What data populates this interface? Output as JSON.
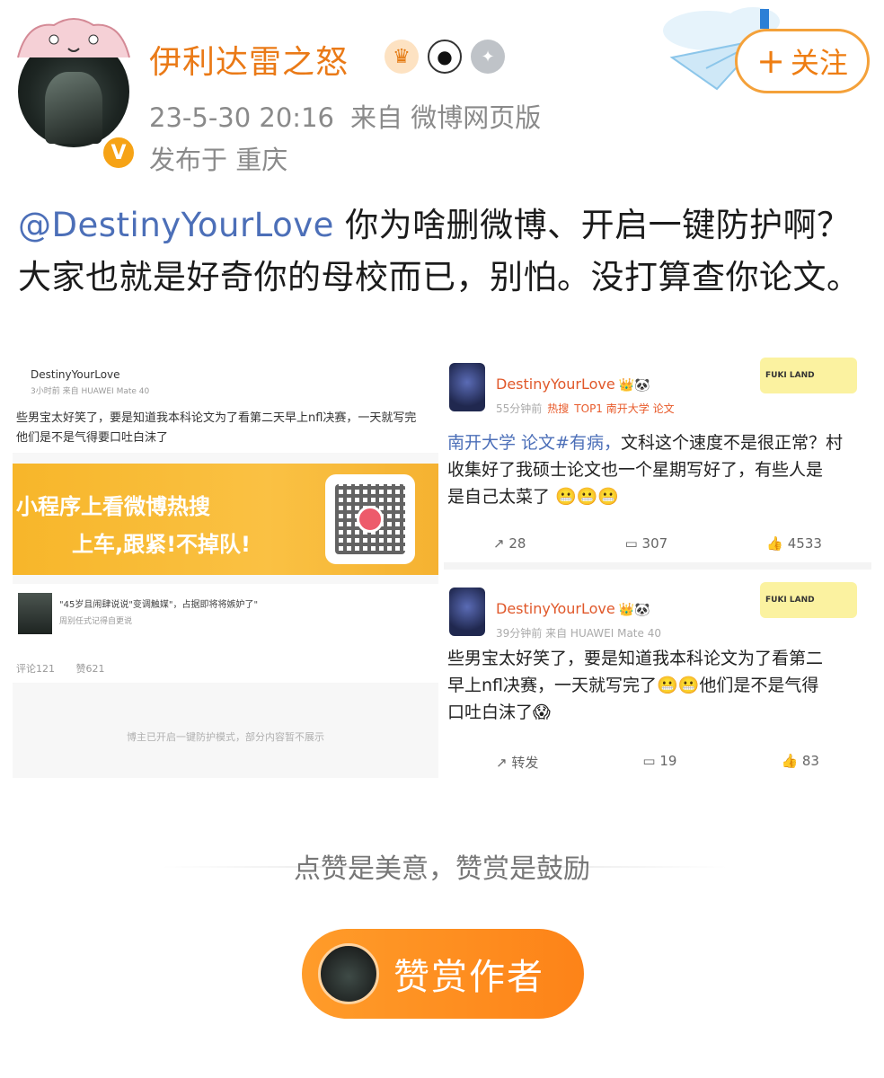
{
  "header": {
    "username": "伊利达雷之怒",
    "time": "23-5-30 20:16",
    "source": "来自 微博网页版",
    "location": "发布于 重庆",
    "follow_label": "关注",
    "verified_mark": "V"
  },
  "post": {
    "mention": "@DestinyYourLove",
    "text": " 你为啥删微博、开启一键防护啊？大家也就是好奇你的母校而已，别怕。没打算查你论文。"
  },
  "left_screenshot": {
    "name": "DestinyYourLove",
    "sub": "3小时前 来自 HUAWEI Mate 40",
    "line1": "些男宝太好笑了，要是知道我本科论文为了看第二天早上nfl决赛，一天就写完",
    "line2": "他们是不是气得要口吐白沫了",
    "banner_line1": "小程序上看微博热搜",
    "banner_line2": "上车,跟紧!不掉队!",
    "card_title": "\"45岁且闹肆说说\"变调触媒\"，占据即将将嫉妒了\"",
    "card_sub": "周别任式记得自更说",
    "card_comments": "评论121",
    "card_likes": "赞621",
    "note": "博主已开启一键防护模式，部分内容暂不展示"
  },
  "right_screenshot": {
    "fuki_label": "FUKI LAND",
    "posts": [
      {
        "name": "DestinyYourLove",
        "time": "55分钟前",
        "hot": "热搜",
        "tag": "TOP1 南开大学 论文",
        "body_line1_prefix": "南开大学 论文#有病，",
        "body_line1_rest": "文科这个速度不是很正常？村",
        "body_line2": "收集好了我硕士论文也一个星期写好了，有些人是",
        "body_line3": "是自己太菜了 😬😬😬",
        "repost": "28",
        "comment": "307",
        "like": "4533"
      },
      {
        "name": "DestinyYourLove",
        "time": "39分钟前",
        "source": "来自 HUAWEI Mate 40",
        "body_line1": "些男宝太好笑了，要是知道我本科论文为了看第二",
        "body_line2": "早上nfl决赛，一天就写完了😬😬他们是不是气得",
        "body_line3": "口吐白沫了😱",
        "repost": "转发",
        "comment": "19",
        "like": "83"
      }
    ]
  },
  "reward": {
    "slogan": "点赞是美意，赞赏是鼓励",
    "button_label": "赞赏作者"
  },
  "colors": {
    "username": "#ea7a17",
    "mention": "#4c6fb8",
    "follow_border": "#f4a13a",
    "reward_button": "#fd8318"
  }
}
